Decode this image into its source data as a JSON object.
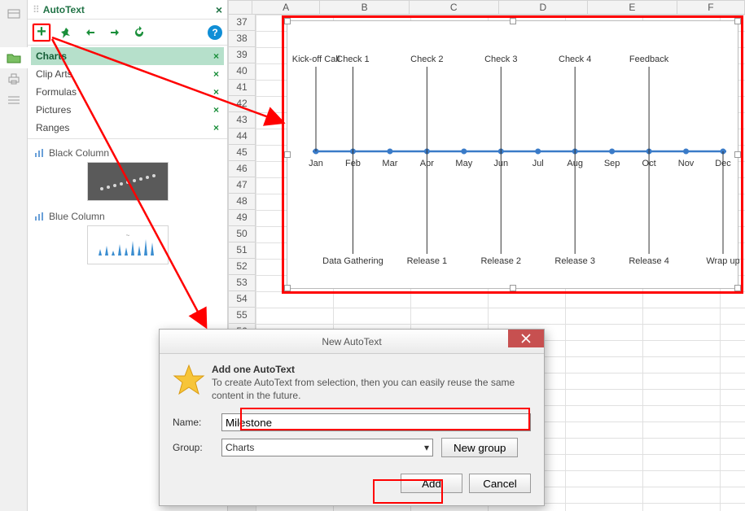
{
  "panel": {
    "title": "AutoText",
    "categories": [
      "Charts",
      "Clip Arts",
      "Formulas",
      "Pictures",
      "Ranges"
    ],
    "active_category": "Charts",
    "previews": [
      {
        "label": "Black Column"
      },
      {
        "label": "Blue Column"
      }
    ]
  },
  "columns": [
    "",
    "A",
    "B",
    "C",
    "D",
    "E",
    "F"
  ],
  "rows_start": 37,
  "rows_end": 56,
  "chart_data": {
    "type": "line",
    "title": "",
    "categories": [
      "Jan",
      "Feb",
      "Mar",
      "Apr",
      "May",
      "Jun",
      "Jul",
      "Aug",
      "Sep",
      "Oct",
      "Nov",
      "Dec"
    ],
    "values": [
      0,
      0,
      0,
      0,
      0,
      0,
      0,
      0,
      0,
      0,
      0,
      0
    ],
    "labels_top": [
      {
        "x": "Jan",
        "text": "Kick-off Call"
      },
      {
        "x": "Feb",
        "text": "Check 1"
      },
      {
        "x": "Apr",
        "text": "Check 2"
      },
      {
        "x": "Jun",
        "text": "Check 3"
      },
      {
        "x": "Aug",
        "text": "Check 4"
      },
      {
        "x": "Oct",
        "text": "Feedback"
      }
    ],
    "labels_bottom": [
      {
        "x": "Feb",
        "text": "Data Gathering"
      },
      {
        "x": "Apr",
        "text": "Release 1"
      },
      {
        "x": "Jun",
        "text": "Release 2"
      },
      {
        "x": "Aug",
        "text": "Release 3"
      },
      {
        "x": "Oct",
        "text": "Release 4"
      },
      {
        "x": "Dec",
        "text": "Wrap up"
      }
    ]
  },
  "dialog": {
    "title": "New AutoText",
    "heading": "Add one AutoText",
    "description": "To create AutoText from selection, then you can easily reuse the same content in the future.",
    "name_label": "Name:",
    "name_value": "Milestone",
    "group_label": "Group:",
    "group_value": "Charts",
    "new_group_btn": "New group",
    "add_btn": "Add",
    "cancel_btn": "Cancel"
  }
}
